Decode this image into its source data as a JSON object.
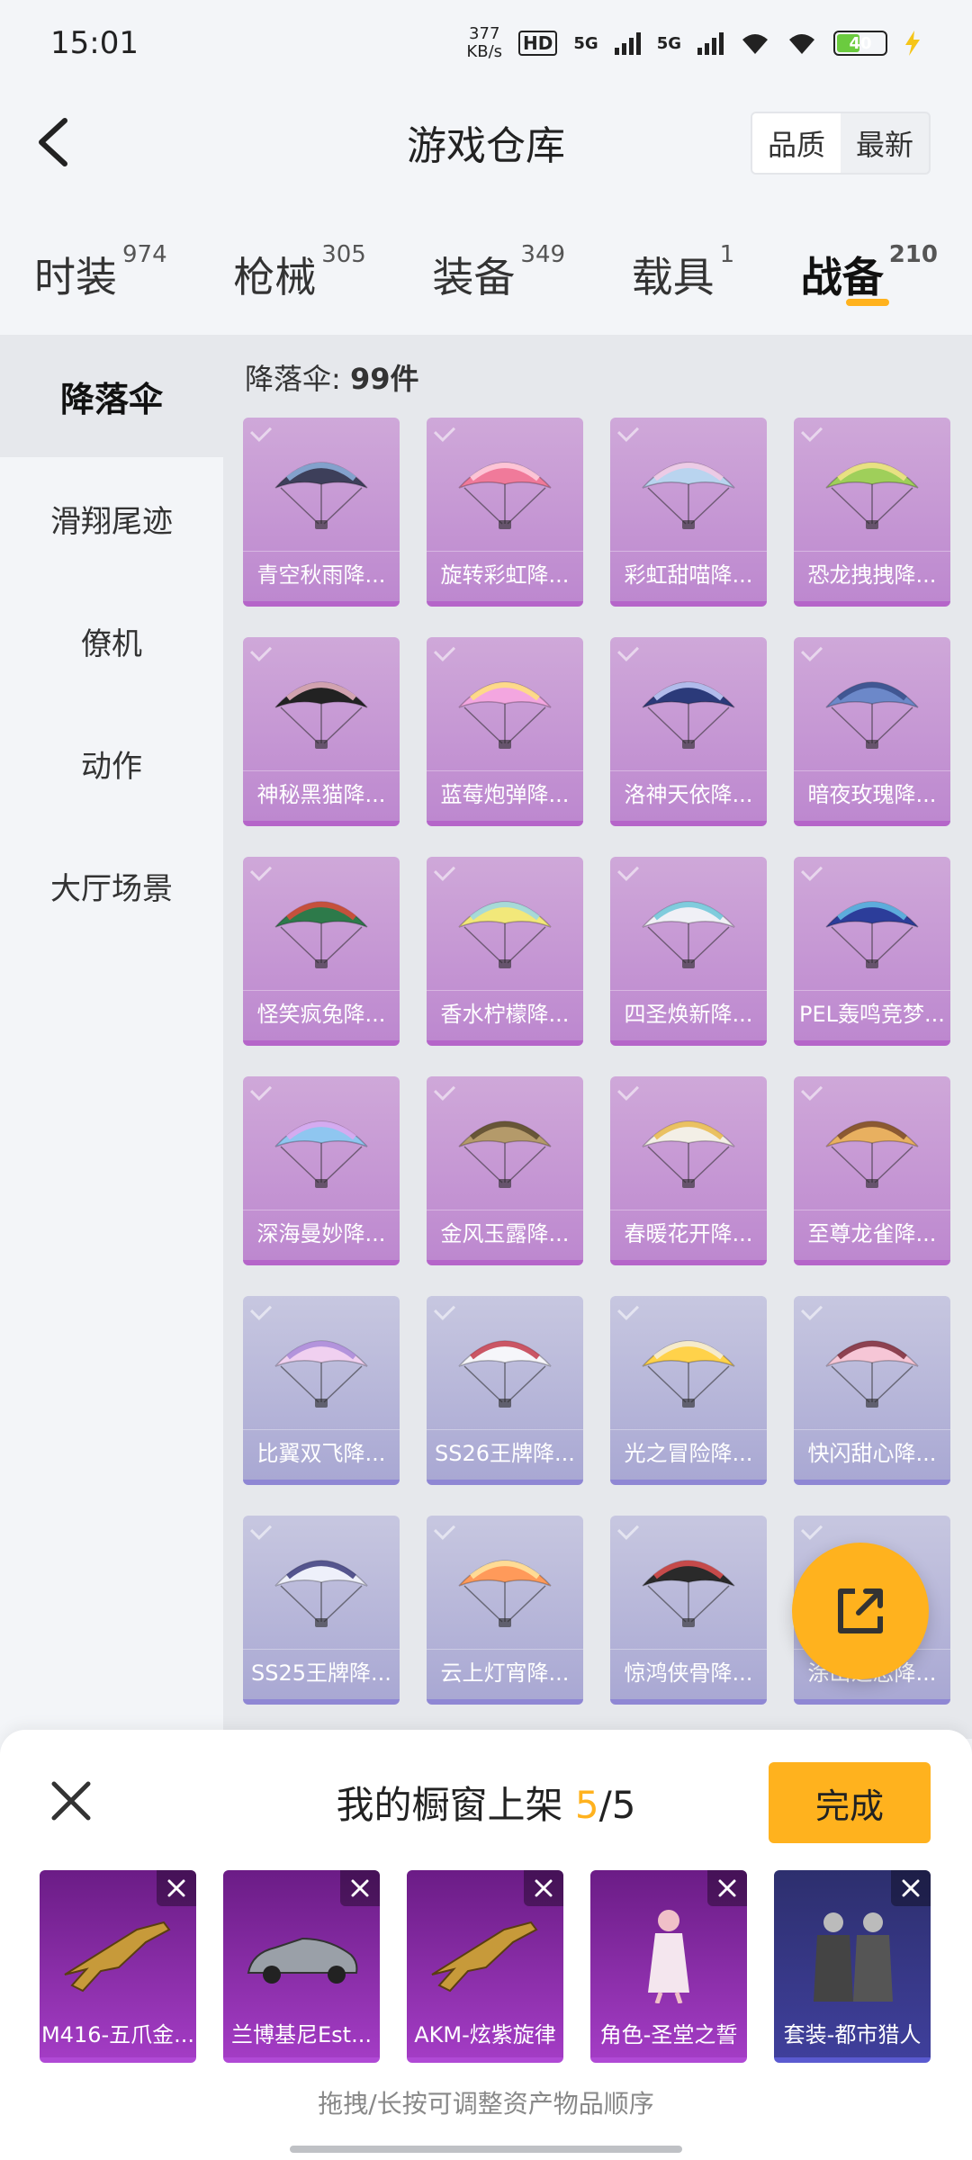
{
  "status": {
    "time": "15:01",
    "net_speed_value": "377",
    "net_speed_unit": "KB/s",
    "hd_label": "HD",
    "sim1_label": "5G",
    "sim2_label": "5G",
    "battery": "40"
  },
  "header": {
    "title": "游戏仓库",
    "sort_quality": "品质",
    "sort_latest": "最新"
  },
  "tabs": [
    {
      "label": "时装",
      "count": "974"
    },
    {
      "label": "枪械",
      "count": "305"
    },
    {
      "label": "装备",
      "count": "349"
    },
    {
      "label": "载具",
      "count": "1"
    },
    {
      "label": "战备",
      "count": "210"
    }
  ],
  "sidebar": {
    "items": [
      "降落伞",
      "滑翔尾迹",
      "僚机",
      "动作",
      "大厅场景"
    ]
  },
  "content": {
    "count_label": "降落伞: ",
    "count_value": "99件",
    "items": [
      {
        "name": "青空秋雨降...",
        "icon": "parachute-icon"
      },
      {
        "name": "旋转彩虹降...",
        "icon": "parachute-icon"
      },
      {
        "name": "彩虹甜喵降...",
        "icon": "parachute-icon"
      },
      {
        "name": "恐龙拽拽降...",
        "icon": "parachute-icon"
      },
      {
        "name": "神秘黑猫降...",
        "icon": "parachute-icon"
      },
      {
        "name": "蓝莓炮弹降...",
        "icon": "parachute-icon"
      },
      {
        "name": "洛神天依降...",
        "icon": "parachute-icon"
      },
      {
        "name": "暗夜玫瑰降...",
        "icon": "parachute-icon"
      },
      {
        "name": "怪笑疯兔降...",
        "icon": "parachute-icon"
      },
      {
        "name": "香水柠檬降...",
        "icon": "parachute-icon"
      },
      {
        "name": "四圣焕新降...",
        "icon": "parachute-icon"
      },
      {
        "name": "PEL轰鸣竞梦...",
        "icon": "parachute-icon"
      },
      {
        "name": "深海曼妙降...",
        "icon": "parachute-icon"
      },
      {
        "name": "金风玉露降...",
        "icon": "parachute-icon"
      },
      {
        "name": "春暖花开降...",
        "icon": "parachute-icon"
      },
      {
        "name": "至尊龙雀降...",
        "icon": "parachute-icon"
      },
      {
        "name": "比翼双飞降...",
        "icon": "parachute-icon"
      },
      {
        "name": "SS26王牌降...",
        "icon": "parachute-icon"
      },
      {
        "name": "光之冒险降...",
        "icon": "parachute-icon"
      },
      {
        "name": "快闪甜心降...",
        "icon": "parachute-icon"
      },
      {
        "name": "SS25王牌降...",
        "icon": "parachute-icon"
      },
      {
        "name": "云上灯宵降...",
        "icon": "parachute-icon"
      },
      {
        "name": "惊鸿侠骨降...",
        "icon": "parachute-icon"
      },
      {
        "name": "涂山之恋降...",
        "icon": "parachute-icon"
      }
    ]
  },
  "sheet": {
    "title_prefix": "我的橱窗上架 ",
    "title_count": "5",
    "title_total": "/5",
    "done_label": "完成",
    "hint": "拖拽/长按可调整资产物品顺序",
    "items": [
      {
        "name": "M416-五爪金...",
        "icon": "rifle-icon"
      },
      {
        "name": "兰博基尼Est...",
        "icon": "car-icon"
      },
      {
        "name": "AKM-炫紫旋律",
        "icon": "rifle-icon"
      },
      {
        "name": "角色-圣堂之誓",
        "icon": "character-icon"
      },
      {
        "name": "套装-都市猎人",
        "icon": "outfit-icon"
      }
    ]
  },
  "colors": {
    "accent": "#ffb21e",
    "card_purple": "#bd88cf",
    "card_blue": "#a9a8d3"
  }
}
